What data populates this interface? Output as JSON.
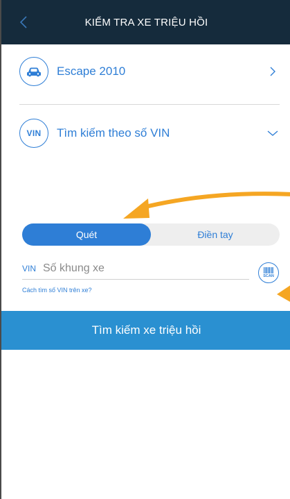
{
  "header": {
    "title": "KIỂM TRA XE TRIỆU HỒI"
  },
  "vehicle_row": {
    "label": "Escape 2010",
    "icon": "car-icon"
  },
  "vin_search_row": {
    "icon_text": "VIN",
    "label": "Tìm kiếm theo số VIN"
  },
  "segment": {
    "active_label": "Quét",
    "inactive_label": "Điền tay"
  },
  "vin_field": {
    "prefix": "VIN",
    "placeholder": "Số khung xe",
    "value": ""
  },
  "scan_button": {
    "label": "SCAN",
    "icon": "barcode-icon"
  },
  "help_link": "Cách tìm số VIN trên xe?",
  "search_button": "Tìm kiếm xe triệu hồi",
  "colors": {
    "header_bg": "#152b3c",
    "accent": "#2e7ed6",
    "button_bg": "#2a90d1",
    "annotation_arrow": "#f5a623"
  }
}
